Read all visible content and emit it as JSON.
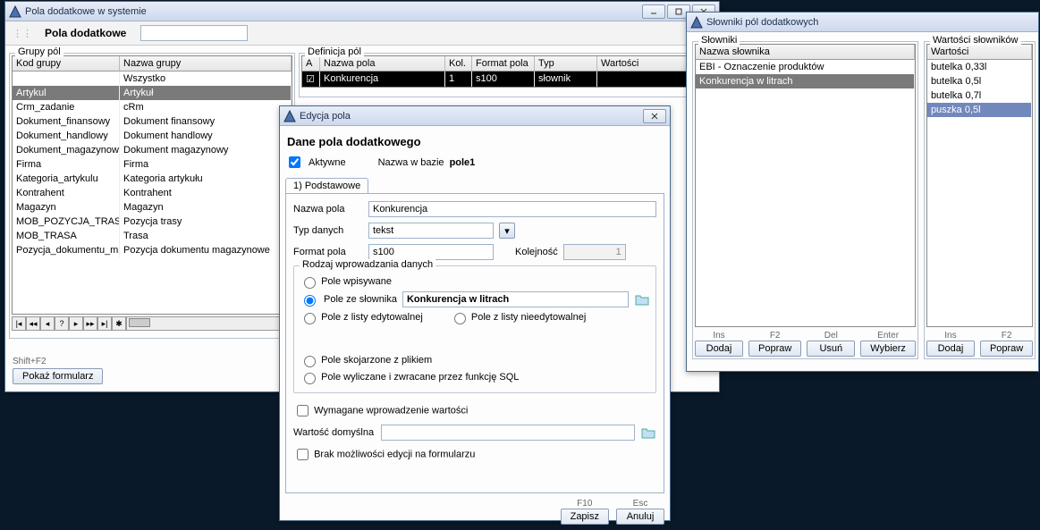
{
  "win1": {
    "title": "Pola dodatkowe w  systemie",
    "section_label": "Pola dodatkowe",
    "group_box": "Grupy pól",
    "col_kod": "Kod grupy",
    "col_nazwa": "Nazwa grupy",
    "rows": [
      {
        "kod": "",
        "nazwa": "Wszystko"
      },
      {
        "kod": "Artykul",
        "nazwa": "Artykuł"
      },
      {
        "kod": "Crm_zadanie",
        "nazwa": "cRm"
      },
      {
        "kod": "Dokument_finansowy",
        "nazwa": "Dokument finansowy"
      },
      {
        "kod": "Dokument_handlowy",
        "nazwa": "Dokument handlowy"
      },
      {
        "kod": "Dokument_magazynowy",
        "nazwa": "Dokument magazynowy"
      },
      {
        "kod": "Firma",
        "nazwa": "Firma"
      },
      {
        "kod": "Kategoria_artykulu",
        "nazwa": "Kategoria artykułu"
      },
      {
        "kod": "Kontrahent",
        "nazwa": "Kontrahent"
      },
      {
        "kod": "Magazyn",
        "nazwa": "Magazyn"
      },
      {
        "kod": "MOB_POZYCJA_TRASY",
        "nazwa": "Pozycja trasy"
      },
      {
        "kod": "MOB_TRASA",
        "nazwa": "Trasa"
      },
      {
        "kod": "Pozycja_dokumentu_ma",
        "nazwa": "Pozycja dokumentu magazynowe"
      }
    ],
    "def_box": "Definicja pól",
    "def_cols": {
      "a": "A",
      "nazwa": "Nazwa pola",
      "kol": "Kol.",
      "format": "Format pola",
      "typ": "Typ",
      "wart": "Wartości"
    },
    "def_row": {
      "a": "☑",
      "nazwa": "Konkurencja",
      "kol": "1",
      "format": "s100",
      "typ": "słownik"
    },
    "status": "Shift+F2",
    "show_form": "Pokaż formularz"
  },
  "win2": {
    "title": "Edycja pola",
    "header": "Dane pola dodatkowego",
    "active": "Aktywne",
    "name_db_lbl": "Nazwa w bazie",
    "name_db_val": "pole1",
    "tab": "1) Podstawowe",
    "lbl_name": "Nazwa pola",
    "val_name": "Konkurencja",
    "lbl_type": "Typ danych",
    "val_type": "tekst",
    "lbl_format": "Format pola",
    "val_format": "s100",
    "lbl_order": "Kolejność",
    "val_order": "1",
    "rgroup": "Rodzaj wprowadzania danych",
    "r1": "Pole wpisywane",
    "r2": "Pole ze słownika",
    "r2_val": "Konkurencja w litrach",
    "r3": "Pole z listy edytowalnej",
    "r4": "Pole z listy nieedytowalnej",
    "r5": "Pole skojarzone z plikiem",
    "r6": "Pole wyliczane i zwracane przez funkcję SQL",
    "chk_req": "Wymagane wprowadzenie wartości",
    "lbl_default": "Wartość domyślna",
    "chk_noedit": "Brak możliwości edycji na formularzu",
    "hint_save": "F10",
    "btn_save": "Zapisz",
    "hint_cancel": "Esc",
    "btn_cancel": "Anuluj"
  },
  "win3": {
    "title": "Słowniki pól dodatkowych",
    "box1": "Słowniki",
    "col1": "Nazwa słownika",
    "rows1": [
      {
        "n": "EBI - Oznaczenie produktów"
      },
      {
        "n": "Konkurencja w litrach"
      }
    ],
    "box2": "Wartości słowników",
    "col2": "Wartości",
    "rows2": [
      {
        "v": "butelka 0,33l"
      },
      {
        "v": "butelka 0,5l"
      },
      {
        "v": "butelka 0,7l"
      },
      {
        "v": "puszka 0,5l"
      }
    ],
    "hints": {
      "ins": "Ins",
      "f2": "F2",
      "del": "Del",
      "enter": "Enter"
    },
    "btns": {
      "add": "Dodaj",
      "edit": "Popraw",
      "del": "Usuń",
      "sel": "Wybierz"
    }
  }
}
